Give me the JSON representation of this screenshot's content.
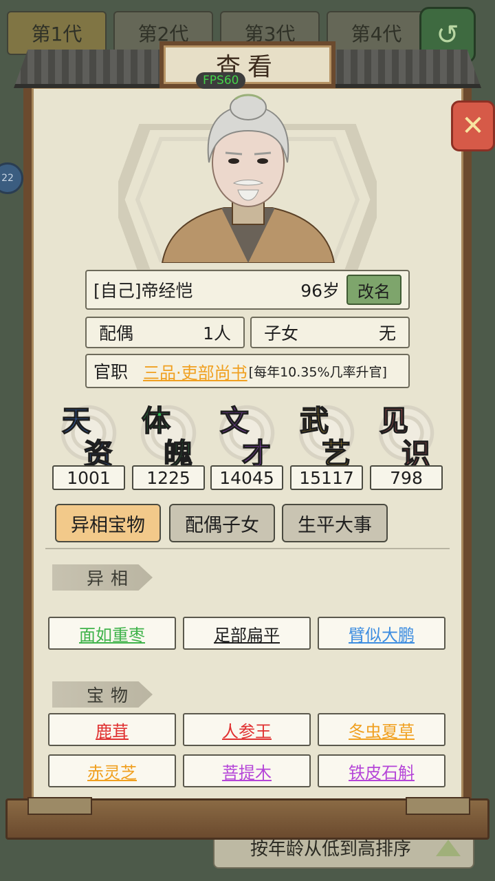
{
  "background": {
    "generation_tabs": [
      "第1代",
      "第2代",
      "第3代",
      "第4代"
    ],
    "left_badge": "22",
    "sort_label": "按年龄从低到高排序"
  },
  "dialog": {
    "title": "查看",
    "fps": "FPS60"
  },
  "person": {
    "name": "[自己]帝经恺",
    "age": "96岁",
    "rename_label": "改名",
    "spouse_label": "配偶",
    "spouse_value": "1人",
    "children_label": "子女",
    "children_value": "无",
    "office_label": "官职",
    "office_title": "三品·吏部尚书",
    "office_note": "[每年10.35%几率升官]"
  },
  "stats": [
    {
      "c1": "天",
      "c2": "资",
      "value": "1001",
      "color": "#3b7be8"
    },
    {
      "c1": "体",
      "c2": "魄",
      "value": "1225",
      "color": "#36c25a"
    },
    {
      "c1": "文",
      "c2": "才",
      "value": "14045",
      "color": "#a24ad8"
    },
    {
      "c1": "武",
      "c2": "艺",
      "value": "15117",
      "color": "#f0c030"
    },
    {
      "c1": "见",
      "c2": "识",
      "value": "798",
      "color": "#e86a6a"
    }
  ],
  "tabs": [
    {
      "label": "异相宝物",
      "active": true
    },
    {
      "label": "配偶子女",
      "active": false
    },
    {
      "label": "生平大事",
      "active": false
    }
  ],
  "sections": {
    "traits_header": "异相",
    "treasures_header": "宝物"
  },
  "traits": [
    {
      "label": "面如重枣",
      "color": "#3fb34a"
    },
    {
      "label": "足部扁平",
      "color": "#1e1e1e"
    },
    {
      "label": "臂似大鹏",
      "color": "#3d8de0"
    }
  ],
  "treasures": [
    {
      "label": "鹿茸",
      "color": "#e03030"
    },
    {
      "label": "人参王",
      "color": "#e03030"
    },
    {
      "label": "冬虫夏草",
      "color": "#f0a020"
    },
    {
      "label": "赤灵芝",
      "color": "#f0a020"
    },
    {
      "label": "菩提木",
      "color": "#b545d8"
    },
    {
      "label": "铁皮石斛",
      "color": "#b545d8"
    }
  ]
}
